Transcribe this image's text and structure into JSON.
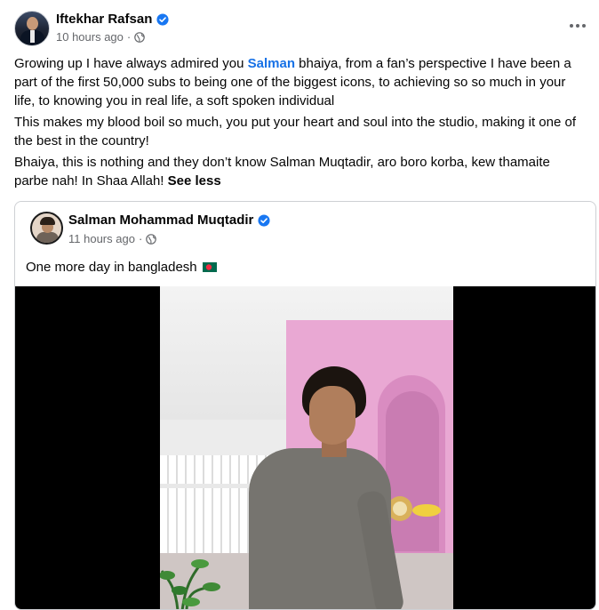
{
  "post": {
    "author": "Iftekhar Rafsan",
    "time": "10 hours ago",
    "separator": "·",
    "p1_before": "Growing up I have always admired you ",
    "p1_mention": "Salman",
    "p1_after": " bhaiya, from a fan’s perspective I have been a part of the first 50,000 subs to being one of the biggest icons, to achieving so so much in your life, to knowing you in real life, a soft spoken individual",
    "p2": "This makes my blood boil so much, you put your heart and soul into the studio, making it one of the best in the country!",
    "p3": "Bhaiya, this is nothing and they don’t know Salman Muqtadir, aro boro korba, kew thamaite parbe nah! In Shaa Allah!",
    "see_less": "See less"
  },
  "shared_post": {
    "author": "Salman Mohammad Muqtadir",
    "time": "11 hours ago",
    "separator": "·",
    "text": "One more day in bangladesh"
  },
  "icons": {
    "verified": "verified-badge-icon",
    "privacy": "globe-icon",
    "more": "more-options-icon",
    "flag": "bangladesh-flag-icon"
  },
  "colors": {
    "link": "#1771e6",
    "verified": "#1877f2",
    "secondary_text": "#65676b",
    "flag_green": "#006a4e",
    "flag_red": "#f42a41"
  }
}
